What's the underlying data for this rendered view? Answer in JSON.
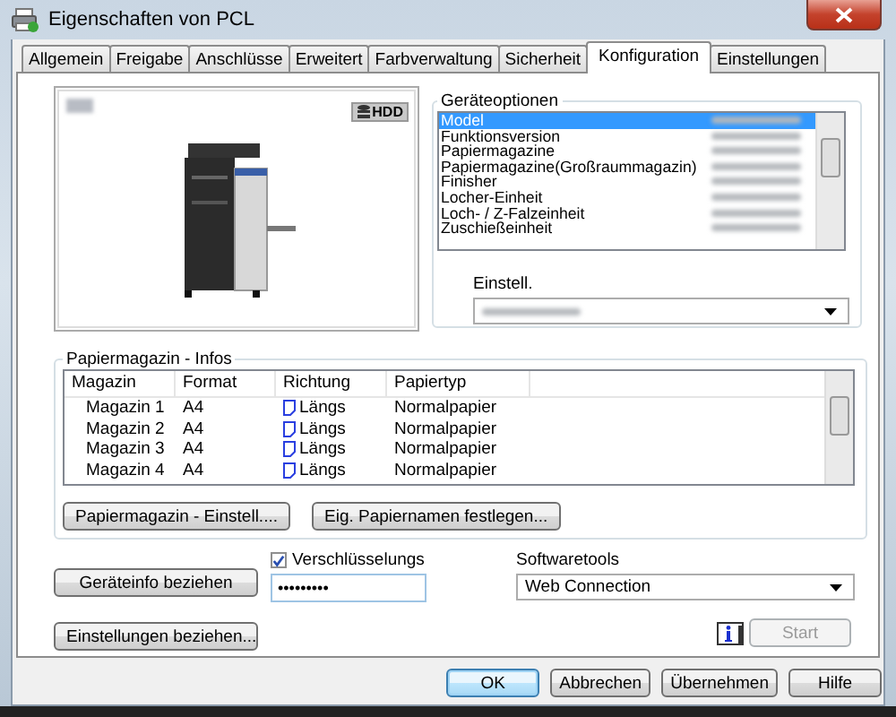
{
  "window": {
    "title": "Eigenschaften von PCL"
  },
  "tabs": [
    {
      "label": "Allgemein",
      "selected": false
    },
    {
      "label": "Freigabe",
      "selected": false
    },
    {
      "label": "Anschlüsse",
      "selected": false
    },
    {
      "label": "Erweitert",
      "selected": false
    },
    {
      "label": "Farbverwaltung",
      "selected": false
    },
    {
      "label": "Sicherheit",
      "selected": false
    },
    {
      "label": "Konfiguration",
      "selected": true
    },
    {
      "label": "Einstellungen",
      "selected": false
    }
  ],
  "device_image": {
    "badge": "HDD"
  },
  "device_options": {
    "title": "Geräteoptionen",
    "items": [
      {
        "label": "Model",
        "selected": true
      },
      {
        "label": "Funktionsversion",
        "selected": false
      },
      {
        "label": "Papiermagazine",
        "selected": false
      },
      {
        "label": "Papiermagazine(Großraummagazin)",
        "selected": false
      },
      {
        "label": "Finisher",
        "selected": false
      },
      {
        "label": "Locher-Einheit",
        "selected": false
      },
      {
        "label": "Loch- / Z-Falzeinheit",
        "selected": false
      },
      {
        "label": "Zuschießeinheit",
        "selected": false
      }
    ],
    "setting_label": "Einstell."
  },
  "tray_info": {
    "title": "Papiermagazin - Infos",
    "columns": [
      "Magazin",
      "Format",
      "Richtung",
      "Papiertyp"
    ],
    "rows": [
      {
        "tray": "Magazin 1",
        "format": "A4",
        "direction": "Längs",
        "paper_type": "Normalpapier"
      },
      {
        "tray": "Magazin 2",
        "format": "A4",
        "direction": "Längs",
        "paper_type": "Normalpapier"
      },
      {
        "tray": "Magazin 3",
        "format": "A4",
        "direction": "Längs",
        "paper_type": "Normalpapier"
      },
      {
        "tray": "Magazin 4",
        "format": "A4",
        "direction": "Längs",
        "paper_type": "Normalpapier"
      }
    ],
    "buttons": [
      "Papiermagazin - Einstell....",
      "Eig. Papiernamen festlegen..."
    ]
  },
  "get_device_info_button": "Geräteinfo beziehen",
  "encryption": {
    "label": "Verschlüsselungs",
    "checked": true,
    "value": "•••••••••"
  },
  "get_settings_button": "Einstellungen beziehen...",
  "software_tools": {
    "label": "Softwaretools",
    "value": "Web Connection",
    "start": {
      "label": "Start",
      "disabled": true
    }
  },
  "buttons": [
    {
      "label": "OK",
      "default": true
    },
    {
      "label": "Abbrechen",
      "default": false
    },
    {
      "label": "Übernehmen",
      "default": false
    },
    {
      "label": "Hilfe",
      "default": false
    }
  ]
}
